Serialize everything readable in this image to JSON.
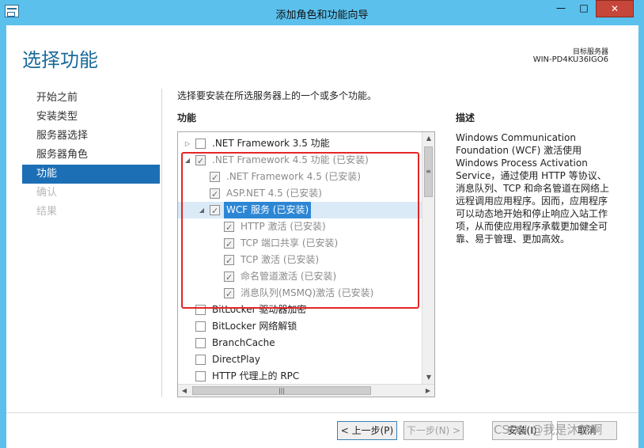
{
  "window": {
    "title": "添加角色和功能向导",
    "min_label": "—",
    "max_label": "□",
    "close_label": "✕"
  },
  "header": {
    "page_title": "选择功能",
    "server_label": "目标服务器",
    "server_name": "WIN-PD4KU36IGO6"
  },
  "nav": {
    "items": [
      {
        "label": "开始之前",
        "state": "normal"
      },
      {
        "label": "安装类型",
        "state": "normal"
      },
      {
        "label": "服务器选择",
        "state": "normal"
      },
      {
        "label": "服务器角色",
        "state": "normal"
      },
      {
        "label": "功能",
        "state": "active"
      },
      {
        "label": "确认",
        "state": "disabled"
      },
      {
        "label": "结果",
        "state": "disabled"
      }
    ]
  },
  "main": {
    "instruction": "选择要安装在所选服务器上的一个或多个功能。",
    "features_heading": "功能",
    "features": [
      {
        "label": ".NET Framework 3.5 功能",
        "checked": false,
        "expand": "▷",
        "gray": false
      },
      {
        "label": ".NET Framework 4.5 功能 (已安装)",
        "checked": true,
        "expand": "◢",
        "gray": true
      },
      {
        "label": ".NET Framework 4.5 (已安装)",
        "checked": true,
        "expand": "",
        "gray": true
      },
      {
        "label": "ASP.NET 4.5 (已安装)",
        "checked": true,
        "expand": "",
        "gray": true
      },
      {
        "label": "WCF 服务 (已安装)",
        "checked": true,
        "expand": "◢",
        "gray": false,
        "selected": true
      },
      {
        "label": "HTTP 激活 (已安装)",
        "checked": true,
        "expand": "",
        "gray": true
      },
      {
        "label": "TCP 端口共享 (已安装)",
        "checked": true,
        "expand": "",
        "gray": true
      },
      {
        "label": "TCP 激活 (已安装)",
        "checked": true,
        "expand": "",
        "gray": true
      },
      {
        "label": "命名管道激活 (已安装)",
        "checked": true,
        "expand": "",
        "gray": true
      },
      {
        "label": "消息队列(MSMQ)激活 (已安装)",
        "checked": true,
        "expand": "",
        "gray": true
      },
      {
        "label": "BitLocker 驱动器加密",
        "checked": false,
        "expand": "",
        "gray": false
      },
      {
        "label": "BitLocker 网络解锁",
        "checked": false,
        "expand": "",
        "gray": false
      },
      {
        "label": "BranchCache",
        "checked": false,
        "expand": "",
        "gray": false
      },
      {
        "label": "DirectPlay",
        "checked": false,
        "expand": "",
        "gray": false
      },
      {
        "label": "HTTP 代理上的 RPC",
        "checked": false,
        "expand": "",
        "gray": false
      }
    ],
    "scroll_up": "▲",
    "scroll_down": "▼",
    "scroll_grip": "≡",
    "scroll_left": "◀",
    "scroll_right": "▶",
    "hscroll_grip": "|||"
  },
  "description": {
    "heading": "描述",
    "text": "Windows Communication Foundation (WCF) 激活使用 Windows Process Activation Service，通过使用 HTTP 等协议、消息队列、TCP 和命名管道在网络上远程调用应用程序。因而，应用程序可以动态地开始和停止响应入站工作项，从而使应用程序承载更加健全可靠、易于管理、更加高效。"
  },
  "footer": {
    "prev_label": "< 上一步(P)",
    "next_label": "下一步(N) >",
    "install_label": "安装(I)",
    "cancel_label": "取消",
    "watermark": "CSDN @我是沐梦啊"
  },
  "colors": {
    "accent": "#1d6fb5",
    "title_blue": "#1a6a9a",
    "highlight_red": "#e32626",
    "titlebar": "#5cc0ec"
  }
}
